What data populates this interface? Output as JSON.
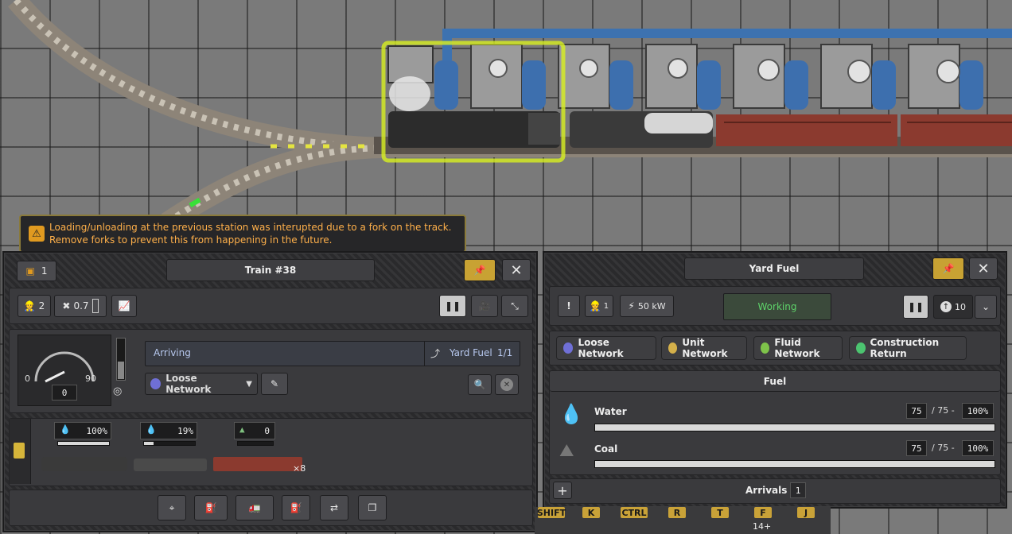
{
  "notice": "Loading/unloading at the previous station was interupted due to a fork on the track. Remove forks to prevent this from happening in the future.",
  "train": {
    "badge_count": "1",
    "title": "Train #38",
    "workers": "2",
    "maintenance": "0.7",
    "speed_min": "0",
    "speed_max": "90",
    "speed_value": "0",
    "status": "Arriving",
    "destination": "Yard Fuel",
    "destination_progress": "1/1",
    "network": "Loose Network",
    "network_color": "#6f6fd6",
    "wagons": [
      {
        "level": "100%",
        "fill": 1.0
      },
      {
        "level": "19%",
        "fill": 0.19
      },
      {
        "level": "0",
        "fill": 0
      }
    ],
    "wagon_multiplier": "×8"
  },
  "station": {
    "title": "Yard Fuel",
    "workers": "1",
    "power": "50 kW",
    "status": "Working",
    "status_color": "#5ed36a",
    "priority": "10",
    "networks": [
      {
        "label": "Loose Network",
        "color": "#6f6fd6"
      },
      {
        "label": "Unit Network",
        "color": "#d4b04a"
      },
      {
        "label": "Fluid Network",
        "color": "#7ec34a"
      },
      {
        "label": "Construction Return",
        "color": "#4cc470"
      }
    ],
    "section_title": "Fuel",
    "resources": [
      {
        "name": "Water",
        "amount": "75",
        "capacity": "/ 75 -",
        "percent": "100%",
        "fill": 1.0
      },
      {
        "name": "Coal",
        "amount": "75",
        "capacity": "/ 75 -",
        "percent": "100%",
        "fill": 1.0
      }
    ],
    "add_label": "+",
    "arrivals_label": "Arrivals",
    "arrivals_count": "1"
  },
  "hotkeys": [
    "SHIFT",
    "K",
    "CTRL",
    "R",
    "T",
    "F",
    "J"
  ],
  "hotkey_extra": "14+"
}
